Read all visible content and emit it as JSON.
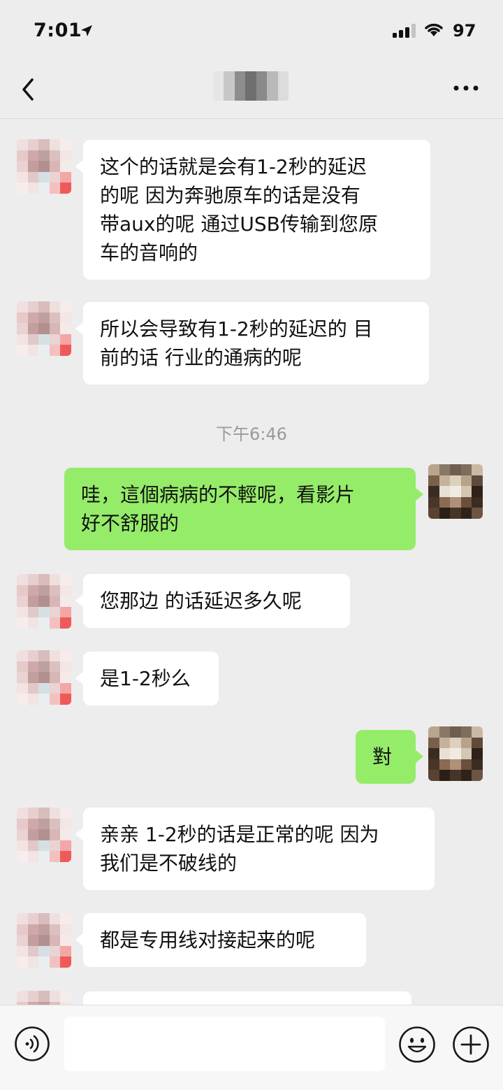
{
  "status_bar": {
    "time": "7:01",
    "battery": "97"
  },
  "nav": {
    "back_icon": "chevron-left-icon",
    "more_icon": "more-dots-icon"
  },
  "messages": [
    {
      "side": "left",
      "text": "这个的话就是会有1-2秒的延迟\n的呢 因为奔驰原车的话是没有\n带aux的呢 通过USB传输到您原\n车的音响的"
    },
    {
      "side": "left",
      "text": "所以会导致有1-2秒的延迟的 目\n前的话 行业的通病的呢"
    },
    {
      "timestamp": "下午6:46"
    },
    {
      "side": "right",
      "text": "哇，這個病病的不輕呢，看影片\n好不舒服的"
    },
    {
      "side": "left",
      "text": "您那边 的话延迟多久呢"
    },
    {
      "side": "left",
      "text": "是1-2秒么"
    },
    {
      "side": "right",
      "text": "對"
    },
    {
      "side": "left",
      "text": "亲亲 1-2秒的话是正常的呢 因为\n我们是不破线的"
    },
    {
      "side": "left",
      "text": "都是专用线对接起来的呢"
    }
  ],
  "input_bar": {
    "voice_icon": "voice-icon",
    "emoji_icon": "emoji-icon",
    "plus_icon": "plus-icon",
    "input_value": ""
  },
  "colors": {
    "background": "#ededed",
    "bubble_self": "#95ec69",
    "bubble_other": "#ffffff",
    "timestamp": "#9a9a9a"
  }
}
